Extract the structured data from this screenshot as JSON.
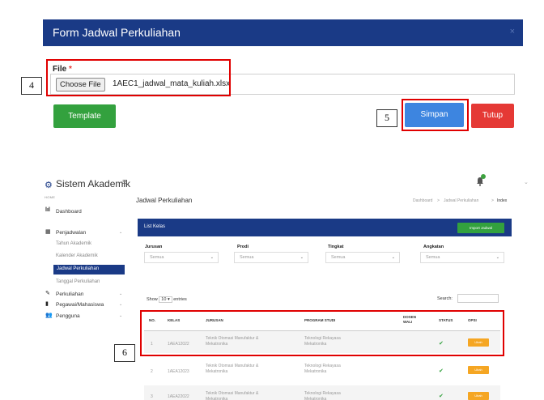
{
  "modal": {
    "title": "Form Jadwal Perkuliahan",
    "close_glyph": "×",
    "file_label": "File",
    "required_mark": "*",
    "choose_button": "Choose File",
    "file_name": "1AEC1_jadwal_mata_kuliah.xlsx",
    "template_button": "Template",
    "simpan_button": "Simpan",
    "tutup_button": "Tutup"
  },
  "annotations": {
    "four": "4",
    "five": "5",
    "six": "6"
  },
  "app": {
    "title": "Sistem Akademik",
    "menu_glyph": "≡",
    "chevron": "⌄"
  },
  "sidebar": {
    "home_label": "HOME",
    "dashboard": "Dashboard",
    "penjadwalan": "Penjadwalan",
    "sub": [
      "Tahun Akademik",
      "Kalender Akademik",
      "Jadwal Perkuliahan",
      "Tanggal Perkuliahan"
    ],
    "perkuliahan": "Perkuliahan",
    "pegawai": "Pegawai/Mahasiswa",
    "pengguna": "Pengguna"
  },
  "page": {
    "title": "Jadwal Perkuliahan",
    "breadcrumb": [
      "Dashboard",
      "Jadwal Perkuliahan",
      "Index"
    ],
    "crumb_sep": ">"
  },
  "card": {
    "title": "List Kelas",
    "import_button": "Import Jadwal"
  },
  "filters": [
    {
      "label": "Jurusan",
      "value": "Semua"
    },
    {
      "label": "Prodi",
      "value": "Semua"
    },
    {
      "label": "Tingkat",
      "value": "Semua"
    },
    {
      "label": "Angkatan",
      "value": "Semua"
    }
  ],
  "table_controls": {
    "show": "Show",
    "entries_value": "10",
    "entries": "entries",
    "search": "Search:"
  },
  "table": {
    "headers": [
      "NO.",
      "KELAS",
      "JURUSAN",
      "PROGRAM STUDI",
      "DOSEN WALI",
      "STATUS",
      "OPSI"
    ],
    "rows": [
      {
        "no": "1",
        "kelas": "1AEA12022",
        "jurusan": "Teknik Otomasi Manufaktur & Mekatronika",
        "prodi": "Teknologi Rekayasa Mekatronika",
        "opsi": "Ubah"
      },
      {
        "no": "2",
        "kelas": "1AEA12023",
        "jurusan": "Teknik Otomasi Manufaktur & Mekatronika",
        "prodi": "Teknologi Rekayasa Mekatronika",
        "opsi": "Ubah"
      },
      {
        "no": "3",
        "kelas": "1AEA22022",
        "jurusan": "Teknik Otomasi Manufaktur & Mekatronika",
        "prodi": "Teknologi Rekayasa Mekatronika",
        "opsi": "Ubah"
      }
    ]
  },
  "colors": {
    "navy": "#1a3a86",
    "green": "#33a13e",
    "blue": "#3d85e0",
    "red": "#e53935",
    "orange": "#f5a623",
    "annotation_red": "#e00000"
  }
}
